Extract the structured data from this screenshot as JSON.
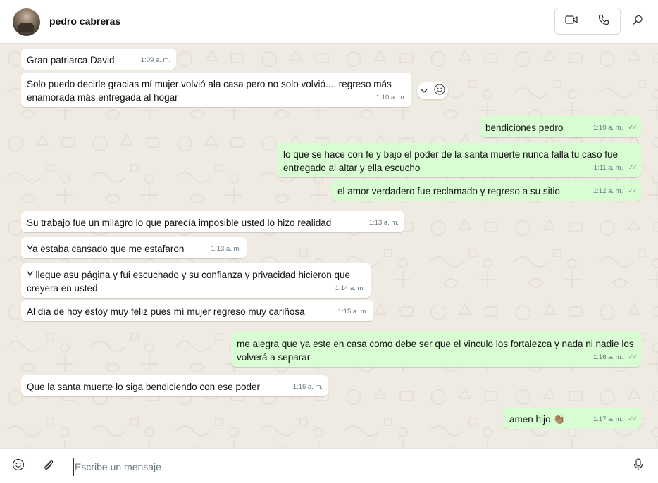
{
  "header": {
    "contact_name": "pedro cabreras",
    "video_call_icon": "video-camera-icon",
    "voice_call_icon": "phone-icon",
    "search_icon": "search-icon"
  },
  "messages": [
    {
      "dir": "in",
      "text": "Gran patriarca David",
      "time": "1:09 a. m."
    },
    {
      "dir": "in",
      "text": "Solo puedo decirle gracias mí mujer volvió ala casa pero no solo volvió.... regreso más enamorada más entregada al hogar",
      "time": "1:10 a. m."
    },
    {
      "dir": "out",
      "text": "bendiciones pedro",
      "time": "1:10 a. m."
    },
    {
      "dir": "out",
      "text": "lo que se hace con fe y bajo el poder de la santa muerte nunca falla tu caso fue entregado al altar y ella escucho",
      "time": "1:11 a. m."
    },
    {
      "dir": "out",
      "text": "el amor verdadero fue reclamado y regreso a su sitio",
      "time": "1:12 a. m."
    },
    {
      "dir": "in",
      "text": "Su trabajo fue un milagro lo que parecía imposible usted lo hizo realidad",
      "time": "1:13 a. m."
    },
    {
      "dir": "in",
      "text": "Ya estaba cansado que me estafaron",
      "time": "1:13 a. m."
    },
    {
      "dir": "in",
      "text": "Y llegue asu página y fui escuchado y su confianza y privacidad hicieron que creyera en usted",
      "time": "1:14 a. m."
    },
    {
      "dir": "in",
      "text": "Al día de hoy estoy muy feliz pues mí mujer regreso muy cariñosa",
      "time": "1:15 a. m."
    },
    {
      "dir": "out",
      "text": "me alegra que ya este en casa como debe ser que el vinculo los fortalezca y nada ni nadie los volverá a separar",
      "time": "1:16 a. m."
    },
    {
      "dir": "in",
      "text": "Que la santa muerte lo siga bendiciendo con ese poder",
      "time": "1:16 a. m."
    },
    {
      "dir": "out",
      "text": "amen hijo.👏🏽",
      "time": "1:17 a. m."
    }
  ],
  "hover_actions": {
    "dropdown_icon": "chevron-down-icon",
    "react_icon": "smiley-icon"
  },
  "composer": {
    "placeholder": "Escribe un mensaje",
    "value": "",
    "emoji_icon": "emoji-icon",
    "attach_icon": "paperclip-icon",
    "mic_icon": "microphone-icon"
  },
  "colors": {
    "incoming_bubble": "#ffffff",
    "outgoing_bubble": "#d9fdd3",
    "chat_background": "#efeae2"
  }
}
